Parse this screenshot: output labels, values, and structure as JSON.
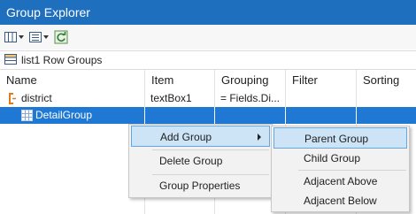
{
  "panel": {
    "title": "Group Explorer"
  },
  "toolbar": {
    "buttons": [
      {
        "name": "layout-icon"
      },
      {
        "name": "view-options-icon"
      },
      {
        "name": "refresh-icon"
      }
    ]
  },
  "section": {
    "label": "list1 Row Groups"
  },
  "columns": [
    "Name",
    "Item",
    "Grouping",
    "Filter",
    "Sorting"
  ],
  "rows": [
    {
      "name": "district",
      "item": "textBox1",
      "grouping": "= Fields.Di...",
      "filter": "",
      "sorting": ""
    },
    {
      "name": "DetailGroup",
      "item": "",
      "grouping": "",
      "filter": "",
      "sorting": ""
    }
  ],
  "context_menu": {
    "items": [
      "Add Group",
      "Delete Group",
      "Group Properties"
    ]
  },
  "submenu": {
    "items": [
      "Parent Group",
      "Child Group",
      "Adjacent Above",
      "Adjacent Below"
    ]
  },
  "colors": {
    "title_bar": "#1f6fbf",
    "selection": "#1f78d4",
    "menu_highlight": "#cde4f7"
  }
}
